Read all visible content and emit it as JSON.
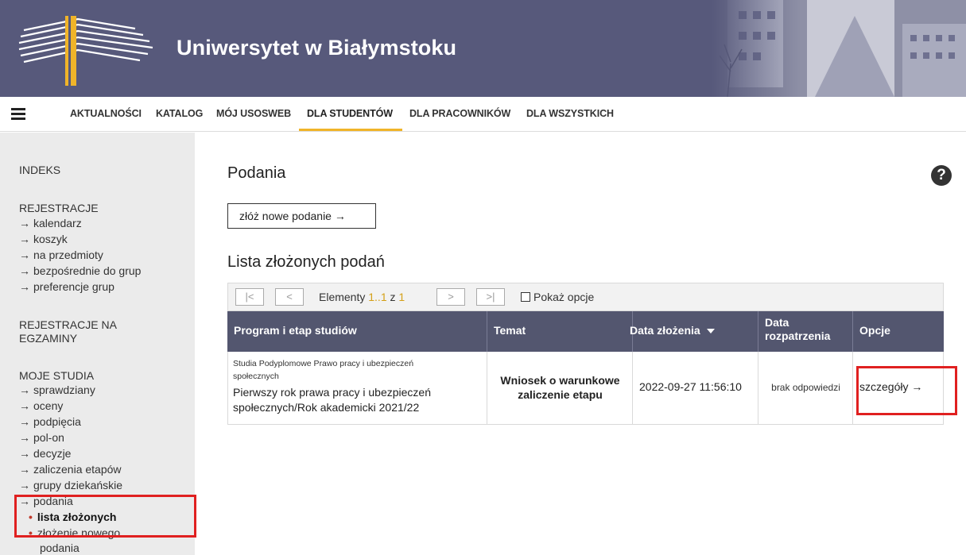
{
  "banner": {
    "title": "Uniwersytet w Białymstoku"
  },
  "menu": {
    "items": [
      "AKTUALNOŚCI",
      "KATALOG",
      "MÓJ USOSWEB",
      "DLA STUDENTÓW",
      "DLA PRACOWNIKÓW",
      "DLA WSZYSTKICH"
    ],
    "active": "DLA STUDENTÓW"
  },
  "sidebar": {
    "indeks": "INDEKS",
    "rejestracje": {
      "title": "REJESTRACJE",
      "links": [
        "kalendarz",
        "koszyk",
        "na przedmioty",
        "bezpośrednie do grup",
        "preferencje grup"
      ]
    },
    "egzaminy": {
      "title_line1": "REJESTRACJE NA",
      "title_line2": "EGZAMINY"
    },
    "studia": {
      "title": "MOJE STUDIA",
      "links": [
        "sprawdziany",
        "oceny",
        "podpięcia",
        "pol-on",
        "decyzje",
        "zaliczenia etapów",
        "grupy dziekańskie",
        "podania"
      ],
      "sub": [
        "lista złożonych",
        "złożenie nowego",
        "podania"
      ]
    }
  },
  "main": {
    "title": "Podania",
    "help": "?",
    "new_button": "złóż nowe podanie →",
    "list_title": "Lista złożonych podań"
  },
  "pager": {
    "first": "|<",
    "prev": "<",
    "label": "Elementy",
    "range": "1..1",
    "of": "z",
    "total": "1",
    "next": ">",
    "last": ">|",
    "show_options": "Pokaż opcje"
  },
  "table": {
    "headers": {
      "program": "Program i etap studiów",
      "temat": "Temat",
      "data_zlozenia": "Data złożenia",
      "data_rozp_1": "Data",
      "data_rozp_2": "rozpatrzenia",
      "opcje": "Opcje"
    },
    "rows": [
      {
        "program_small_1": "Studia Podyplomowe Prawo pracy i ubezpieczeń",
        "program_small_2": "społecznych",
        "program_1": "Pierwszy rok prawa pracy i ubezpieczeń",
        "program_2": "społecznych/Rok akademicki 2021/22",
        "temat_1": "Wniosek o warunkowe",
        "temat_2": "zaliczenie etapu",
        "data_zlozenia": "2022-09-27 11:56:10",
        "data_rozpatrzenia": "brak odpowiedzi",
        "opcje": "szczegóły →"
      }
    ]
  },
  "colors": {
    "banner": "#57597b",
    "table_header": "#53566f",
    "accent": "#f0b429",
    "highlight": "#e02020"
  }
}
